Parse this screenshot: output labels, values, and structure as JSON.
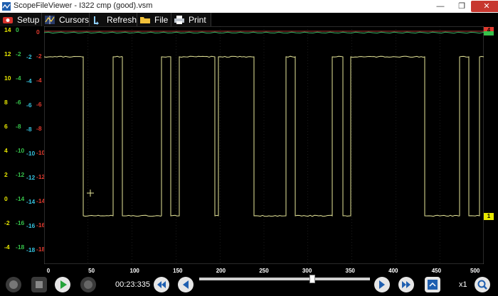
{
  "window": {
    "title": "ScopeFileViewer - I322 cmp (good).vsm",
    "minimize": "—",
    "maximize": "❐",
    "close": "✕"
  },
  "toolbar": {
    "setup": "Setup",
    "cursors": "Cursors",
    "refresh": "Refresh",
    "file": "File",
    "print": "Print"
  },
  "axes": {
    "yellow_ticks": [
      "14",
      "12",
      "10",
      "8",
      "6",
      "4",
      "2",
      "0",
      "-2",
      "-4"
    ],
    "green_ticks": [
      "0",
      "-2",
      "-4",
      "-6",
      "-8",
      "-10",
      "-12",
      "-14",
      "-16",
      "-18"
    ],
    "cyan_ticks": [
      "-2",
      "-4",
      "-6",
      "-8",
      "-10",
      "-12",
      "-14",
      "-16",
      "-18"
    ],
    "red_ticks": [
      "0",
      "-2",
      "-4",
      "-6",
      "-8",
      "-10",
      "-12",
      "-14",
      "-16",
      "-18"
    ],
    "x_ticks": [
      "0",
      "50",
      "100",
      "150",
      "200",
      "250",
      "300",
      "350",
      "400",
      "450",
      "500 ms"
    ]
  },
  "markers": {
    "channel_red": "4",
    "channel_yellow": "1"
  },
  "playback": {
    "time": "00:23:335",
    "zoom": "x1"
  },
  "colors": {
    "signal": "#e8e89a",
    "green_trace": "#3fb86a",
    "yellow": "#e8e800",
    "green": "#36c24a",
    "cyan": "#36c4e0",
    "red": "#e03a2e",
    "grid": "#3a3a3a"
  }
}
